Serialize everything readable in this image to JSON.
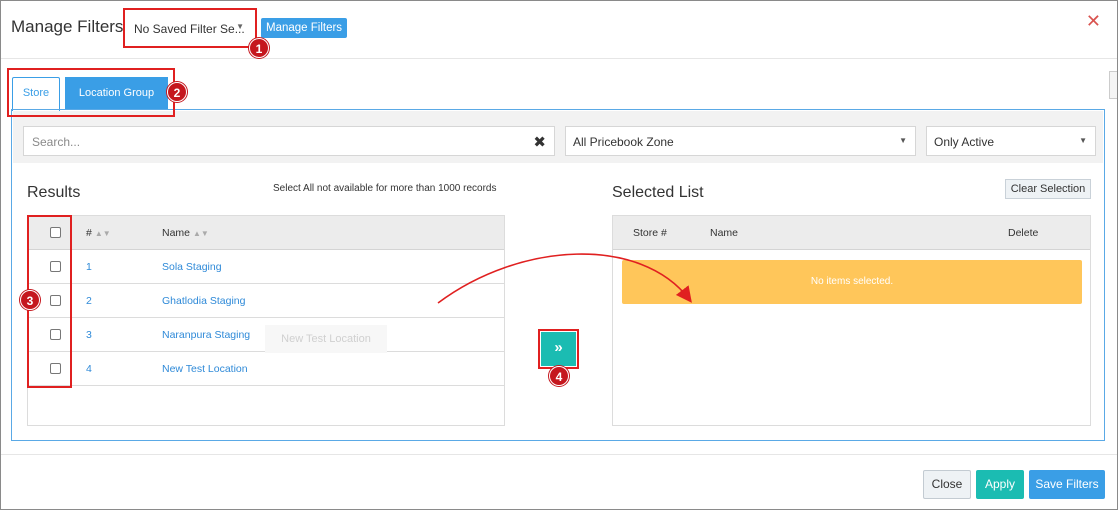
{
  "header": {
    "title": "Manage Filters",
    "saved_filter_value": "No Saved Filter Se...",
    "manage_filters_button": "Manage Filters",
    "close_symbol": "✕"
  },
  "tabs": [
    {
      "label": "Store",
      "active": false
    },
    {
      "label": "Location Group",
      "active": true
    }
  ],
  "filters": {
    "search_placeholder": "Search...",
    "clear_symbol": "✖",
    "pricebook_zone": "All Pricebook Zone",
    "status": "Only Active"
  },
  "results": {
    "title": "Results",
    "note": "Select All not available for more than 1000 records",
    "columns": {
      "number": "#",
      "name": "Name"
    },
    "rows": [
      {
        "id": "1",
        "name": "Sola Staging"
      },
      {
        "id": "2",
        "name": "Ghatlodia Staging"
      },
      {
        "id": "3",
        "name": "Naranpura Staging"
      },
      {
        "id": "4",
        "name": "New Test Location"
      }
    ],
    "drag_ghost": "New Test Location"
  },
  "move_button_symbol": "»",
  "selected": {
    "title": "Selected List",
    "clear_button": "Clear Selection",
    "columns": {
      "store": "Store #",
      "name": "Name",
      "delete": "Delete"
    },
    "empty_message": "No items selected."
  },
  "footer": {
    "close": "Close",
    "apply": "Apply",
    "save": "Save Filters"
  },
  "annotations": [
    "1",
    "2",
    "3",
    "4"
  ],
  "colors": {
    "primary": "#3a9ee6",
    "teal": "#1bbcb2",
    "warning": "#ffc65a",
    "annotation_red": "#e02020"
  }
}
